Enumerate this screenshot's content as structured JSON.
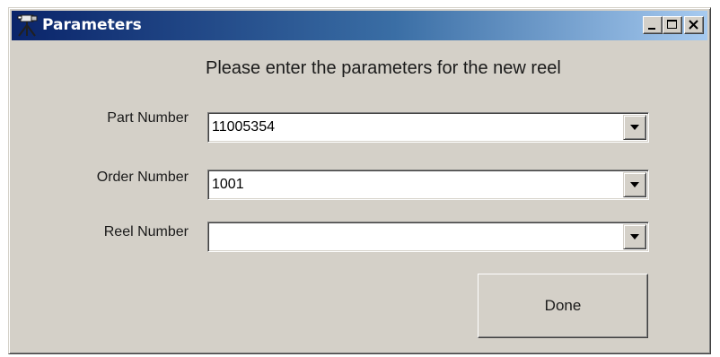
{
  "window": {
    "title": "Parameters",
    "icon": "camera-tripod-icon",
    "controls": {
      "minimize": "minimize-icon",
      "maximize": "maximize-icon",
      "close": "close-icon"
    }
  },
  "form": {
    "heading": "Please enter the parameters for the new reel",
    "fields": [
      {
        "label": "Part Number",
        "value": "11005354"
      },
      {
        "label": "Order Number",
        "value": "1001"
      },
      {
        "label": "Reel Number",
        "value": ""
      }
    ],
    "done_label": "Done"
  },
  "colors": {
    "titlebar_start": "#0a246a",
    "titlebar_end": "#a6caf0",
    "face": "#d4d0c8"
  }
}
